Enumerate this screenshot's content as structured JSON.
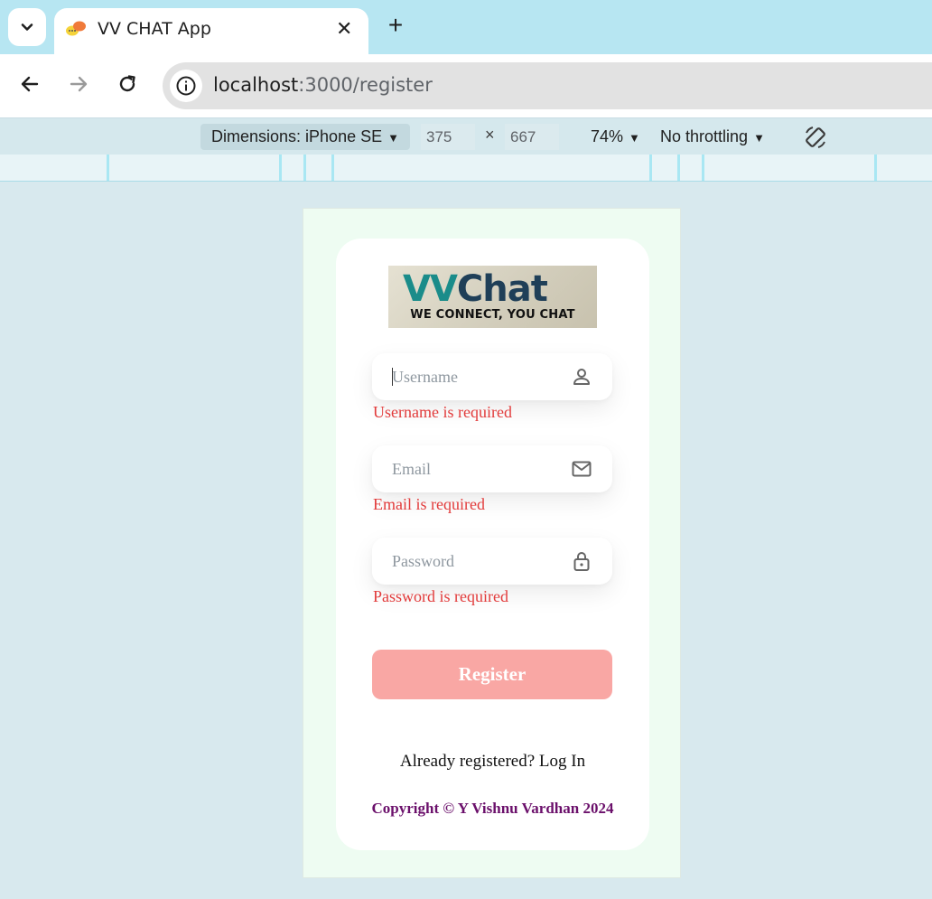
{
  "browser": {
    "tab_title": "VV CHAT App",
    "tab_close": "✕",
    "new_tab": "+",
    "url_host": "localhost",
    "url_path": ":3000/register"
  },
  "devtools": {
    "dimensions_label": "Dimensions: iPhone SE",
    "width": "375",
    "times": "×",
    "height": "667",
    "zoom": "74%",
    "throttling": "No throttling",
    "caret": "▼"
  },
  "app": {
    "logo": {
      "part1": "VV",
      "part2": "Chat",
      "tagline": "WE CONNECT, YOU CHAT"
    },
    "username": {
      "placeholder": "Username",
      "error": "Username is required"
    },
    "email": {
      "placeholder": "Email",
      "error": "Email is required"
    },
    "password": {
      "placeholder": "Password",
      "error": "Password is required"
    },
    "register_label": "Register",
    "login_prompt": "Already registered? Log In",
    "copyright": "Copyright © Y Vishnu Vardhan 2024"
  },
  "colors": {
    "tabstrip": "#b7e6f2",
    "error": "#e23b3b",
    "button": "#f9a7a4",
    "copyright": "#6b106b",
    "viewport_bg": "#eefcf2"
  },
  "icons": {
    "tab_menu": "chevron-down-icon",
    "favicon": "chat-bubbles-icon",
    "back": "arrow-left-icon",
    "forward": "arrow-right-icon",
    "reload": "reload-icon",
    "site_info": "info-icon",
    "rotate": "rotate-icon",
    "username": "user-icon",
    "email": "mail-icon",
    "password": "lock-icon"
  }
}
